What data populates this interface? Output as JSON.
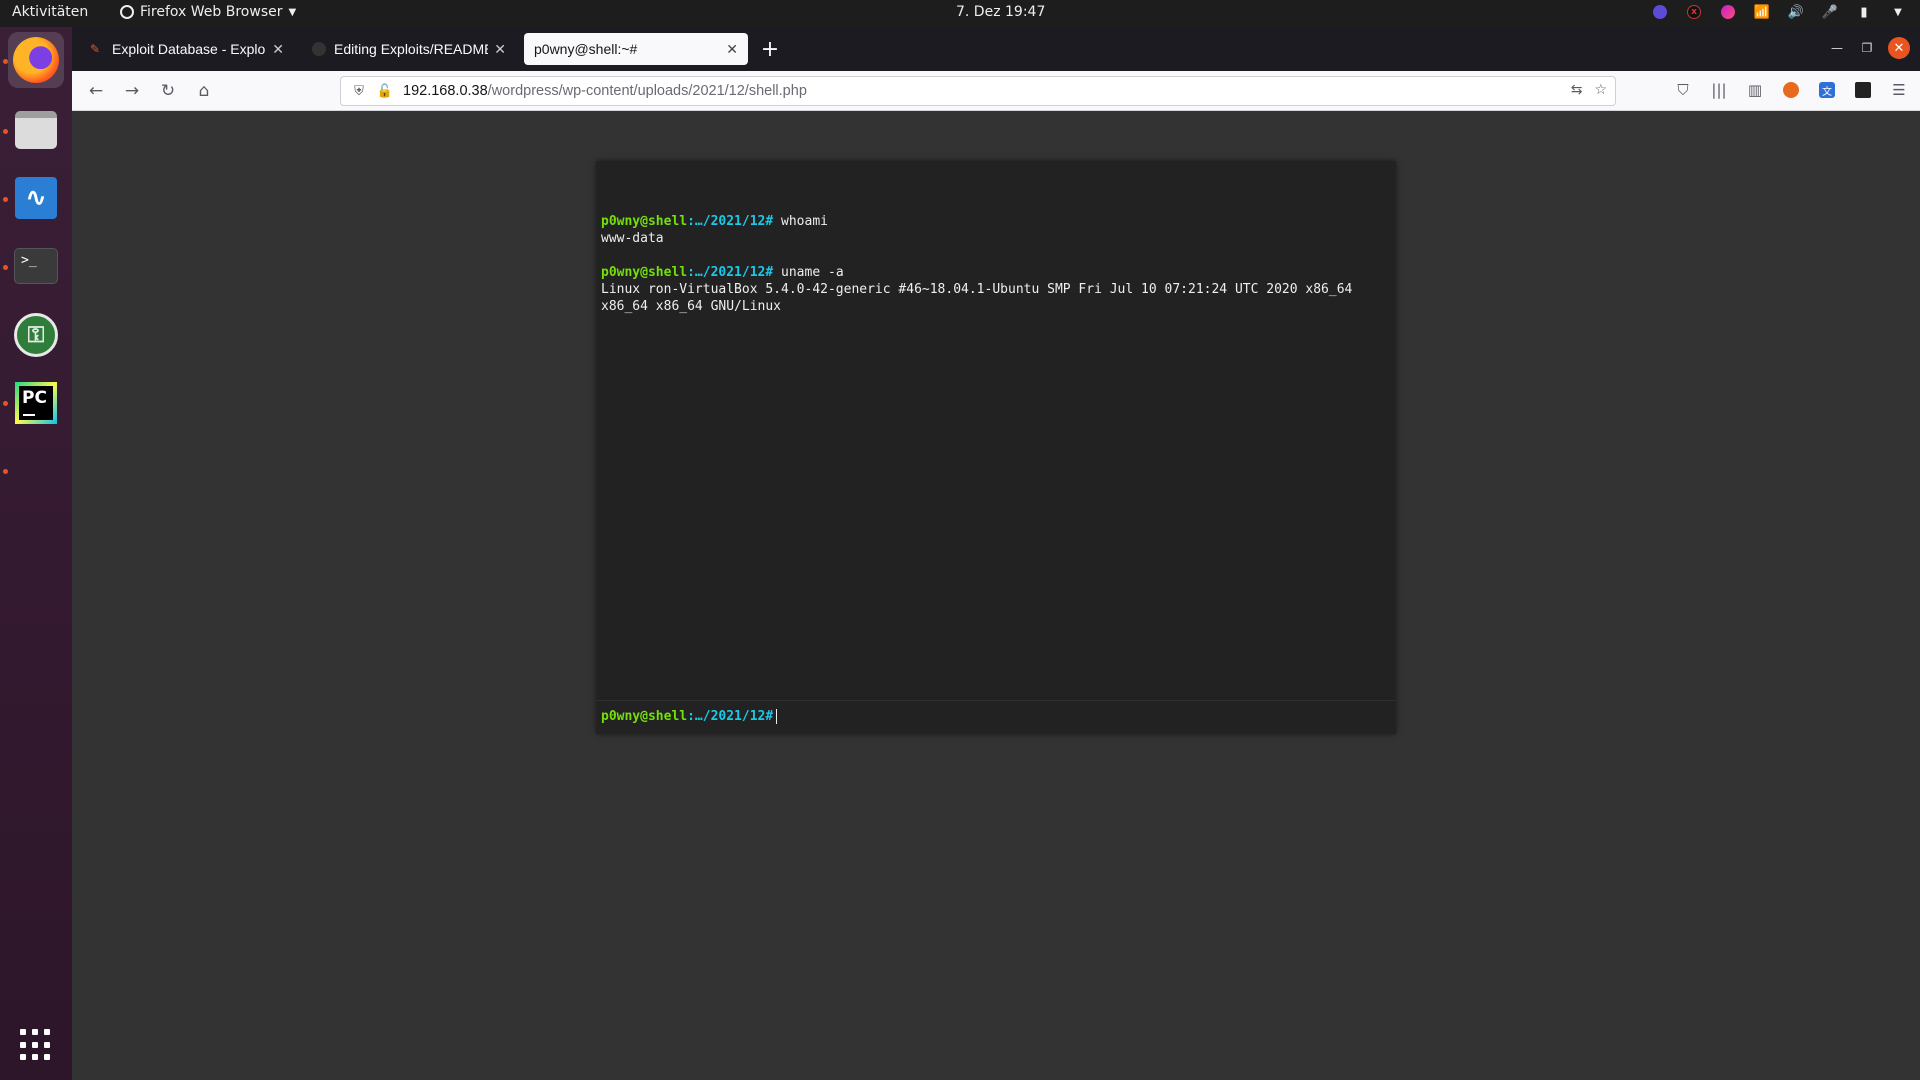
{
  "topbar": {
    "activities": "Aktivitäten",
    "app_name": "Firefox Web Browser",
    "clock": "7. Dez  19:47"
  },
  "dock": {
    "items": [
      "firefox-icon",
      "files-icon",
      "system-monitor-icon",
      "terminal-icon",
      "keepassxc-icon",
      "pycharm-icon"
    ],
    "terminal_glyph": ">_",
    "pycharm_label": "PC"
  },
  "tabs": [
    {
      "label": "Exploit Database - Exploi",
      "icon": "exploit-db-icon"
    },
    {
      "label": "Editing Exploits/README",
      "icon": "github-icon"
    },
    {
      "label": "p0wny@shell:~#",
      "icon": "none",
      "active": true
    }
  ],
  "url": {
    "host": "192.168.0.38",
    "path": "/wordpress/wp-content/uploads/2021/12/shell.php"
  },
  "shell": {
    "user": "p0wny@shell",
    "path": ":…/2021/12",
    "hash": "#",
    "history": [
      {
        "command": "whoami",
        "output": "www-data"
      },
      {
        "command": "uname -a",
        "output": "Linux ron-VirtualBox 5.4.0-42-generic #46~18.04.1-Ubuntu SMP Fri Jul 10 07:21:24 UTC 2020 x86_64 x86_64 x86_64 GNU/Linux"
      }
    ],
    "input_value": ""
  },
  "colors": {
    "prompt_user": "#75df0b",
    "prompt_path": "#1bc9e7",
    "shell_bg": "#222222",
    "page_bg": "#333333",
    "ubuntu_orange": "#e95420"
  }
}
